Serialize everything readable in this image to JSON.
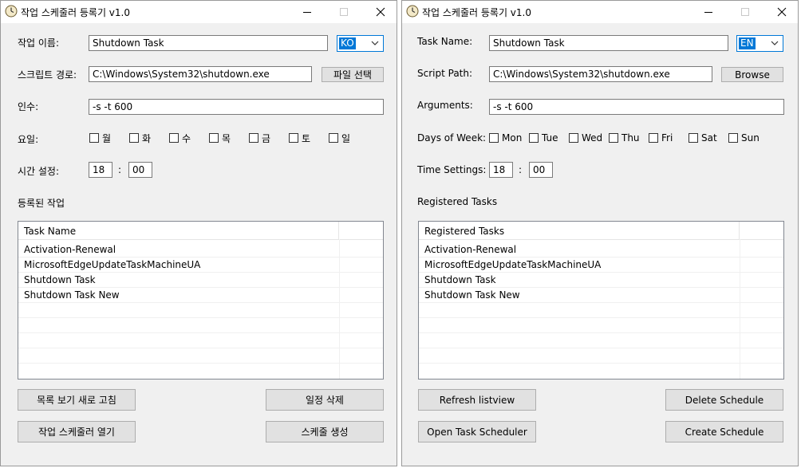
{
  "ko": {
    "title": "작업 스케줄러 등록기 v1.0",
    "task_name_label": "작업 이름:",
    "task_name_value": "Shutdown Task",
    "lang_value": "KO",
    "script_path_label": "스크립트 경로:",
    "script_path_value": "C:\\Windows\\System32\\shutdown.exe",
    "browse_label": "파일 선택",
    "args_label": "인수:",
    "args_value": "-s -t 600",
    "days_label": "요일:",
    "days": [
      "월",
      "화",
      "수",
      "목",
      "금",
      "토",
      "일"
    ],
    "time_label": "시간 설정:",
    "hour": "18",
    "time_sep": ":",
    "minute": "00",
    "registered_label": "등록된 작업",
    "column_header": "Task Name",
    "tasks": [
      "Activation-Renewal",
      "MicrosoftEdgeUpdateTaskMachineUA",
      "Shutdown Task",
      "Shutdown Task New"
    ],
    "refresh_label": "목록 보기 새로 고침",
    "delete_label": "일정 삭제",
    "open_label": "작업 스케줄러 열기",
    "create_label": "스케줄 생성"
  },
  "en": {
    "title": "작업 스케줄러 등록기 v1.0",
    "task_name_label": "Task Name:",
    "task_name_value": "Shutdown Task",
    "lang_value": "EN",
    "script_path_label": "Script Path:",
    "script_path_value": "C:\\Windows\\System32\\shutdown.exe",
    "browse_label": "Browse",
    "args_label": "Arguments:",
    "args_value": "-s -t 600",
    "days_label": "Days of Week:",
    "days": [
      "Mon",
      "Tue",
      "Wed",
      "Thu",
      "Fri",
      "Sat",
      "Sun"
    ],
    "time_label": "Time Settings:",
    "hour": "18",
    "time_sep": ":",
    "minute": "00",
    "registered_label": "Registered Tasks",
    "column_header": "Registered Tasks",
    "tasks": [
      "Activation-Renewal",
      "MicrosoftEdgeUpdateTaskMachineUA",
      "Shutdown Task",
      "Shutdown Task New"
    ],
    "refresh_label": "Refresh listview",
    "delete_label": "Delete Schedule",
    "open_label": "Open Task Scheduler",
    "create_label": "Create Schedule"
  },
  "icons": {
    "app": "clock-icon",
    "minimize": "minimize-icon",
    "maximize": "maximize-icon",
    "close": "close-icon",
    "dropdown": "chevron-down-icon"
  },
  "colors": {
    "accent": "#0078d7",
    "window_bg": "#f0f0f0",
    "button_bg": "#e1e1e1"
  }
}
